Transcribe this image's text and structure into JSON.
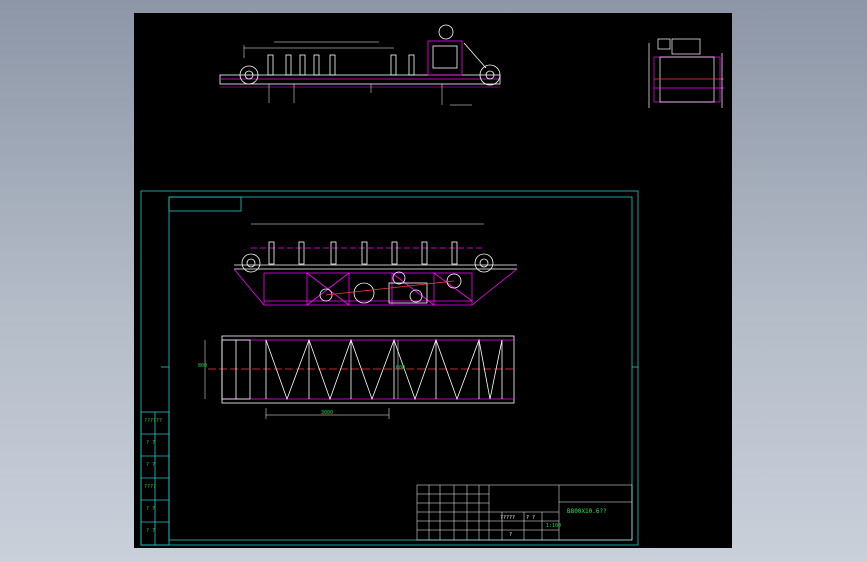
{
  "drawing": {
    "title_block_label": "B800X10.6??",
    "scale_value": "1:100",
    "dim_plan_length": "3000",
    "dim_plan_width": "800",
    "dim_plan_width_inner": "600"
  },
  "left_column_labels": [
    "??????",
    "? ?",
    "? ?",
    "????",
    "? ?",
    "? ?"
  ],
  "table_cells": [
    "?????",
    "? ?",
    "?"
  ],
  "colors": {
    "background": "#000000",
    "frame": "#22c7c7",
    "structure": "#ff00ff",
    "outline": "#ffffff",
    "centerline": "#ff3b3b",
    "text": "#2bd34f"
  }
}
